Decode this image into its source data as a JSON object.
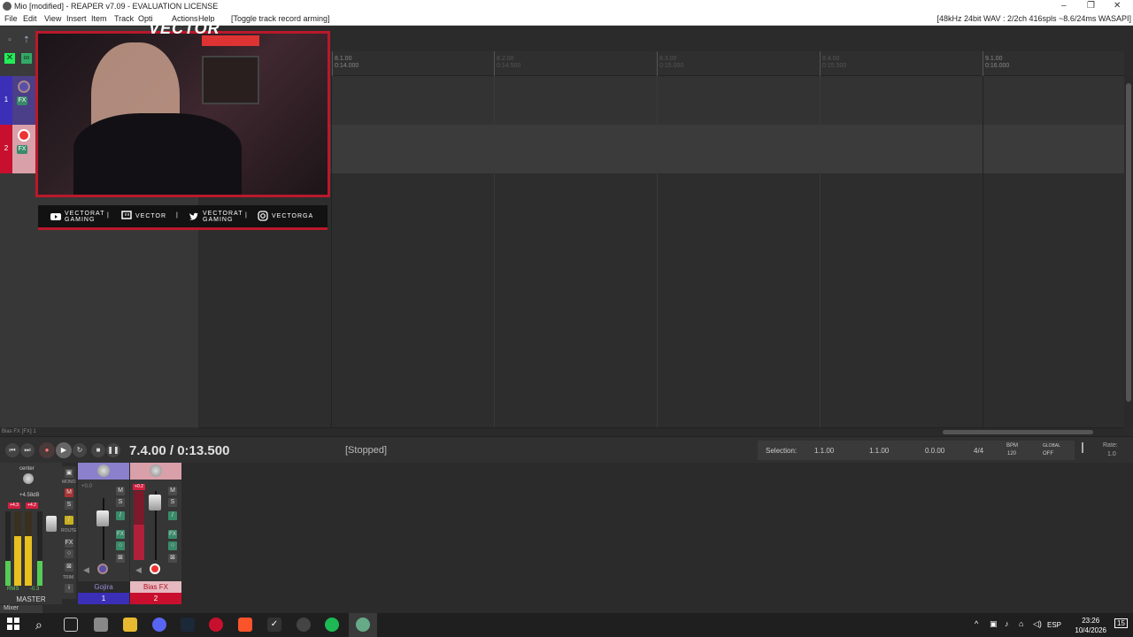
{
  "window": {
    "title": "Mio [modified] - REAPER v7.09 - EVALUATION LICENSE",
    "minimize": "–",
    "maximize": "❐",
    "close": "✕"
  },
  "menu": {
    "items": [
      "File",
      "Edit",
      "View",
      "Insert",
      "Item",
      "Track",
      "Opti",
      "Actions",
      "Help"
    ],
    "last_action": "[Toggle track record arming]",
    "audio_status": "[48kHz 24bit WAV : 2/2ch 416spls ~8.6/24ms WASAPI]"
  },
  "tracks": [
    {
      "number": "1",
      "fx": "FX",
      "color": "#3b2fb8"
    },
    {
      "number": "2",
      "fx": "FX",
      "color": "#c8102e"
    }
  ],
  "ruler": {
    "marks": [
      {
        "bar": "8.1.00",
        "time": "0:14.000"
      },
      {
        "bar": "8.2.00",
        "time": "0:14.500"
      },
      {
        "bar": "8.3.00",
        "time": "0:15.000"
      },
      {
        "bar": "8.4.00",
        "time": "0:15.500"
      },
      {
        "bar": "9.1.00",
        "time": "0:16.000"
      }
    ]
  },
  "overlay": {
    "brand": "VECTOR",
    "social": [
      {
        "icon": "youtube-icon",
        "label": "VECTORAT GAMING"
      },
      {
        "icon": "twitch-icon",
        "label": "VECTOR"
      },
      {
        "icon": "twitter-icon",
        "label": "VECTORAT GAMING"
      },
      {
        "icon": "instagram-icon",
        "label": "VECTORGA"
      }
    ]
  },
  "transport": {
    "track_label": "Bias FX [FX] 1",
    "time": "7.4.00 / 0:13.500",
    "state": "[Stopped]",
    "selection_label": "Selection:",
    "sel_start": "1.1.00",
    "sel_end": "1.1.00",
    "sel_len": "0.0.00",
    "time_sig": "4/4",
    "bpm_label": "BPM",
    "bpm": "120",
    "global_label": "GLOBAL",
    "global_state": "OFF",
    "rate_label": "Rate:",
    "rate": "1.0"
  },
  "mixer": {
    "master": {
      "pan": "center",
      "peak": "+4.58dB",
      "peak_l": "+4.3",
      "peak_r": "+4.2",
      "rms_label": "RMS",
      "rms_value": "-0.3",
      "name": "MASTER",
      "mono": "MONO",
      "route": "ROUTE",
      "trim": "TRIM",
      "fx": "FX"
    },
    "strips": [
      {
        "name": "Gojira",
        "number": "1",
        "volume": "+0.0",
        "color": "#3b2fb8",
        "name_bg": "#2a2a2a",
        "name_color": "#9b8bd8"
      },
      {
        "name": "Bias FX",
        "number": "2",
        "volume": "+0.2",
        "color": "#c8102e",
        "name_bg": "#e6b8c0",
        "name_color": "#b01020"
      }
    ],
    "tab_label": "Mixer"
  },
  "taskbar": {
    "time": "23:26",
    "date": "10/4/2026",
    "lang": "ESP",
    "notif": "15"
  }
}
